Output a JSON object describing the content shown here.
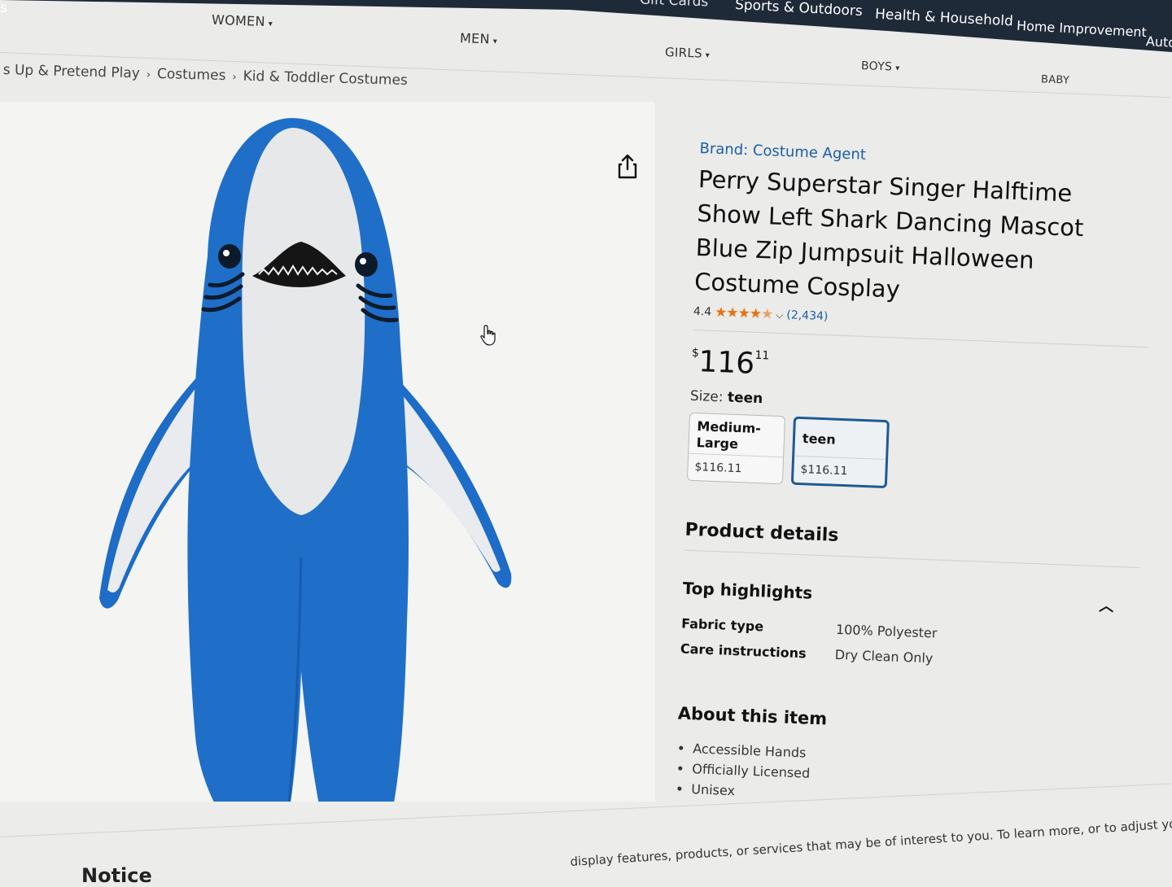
{
  "top_nav": {
    "items": [
      "Gift Cards",
      "Sports & Outdoors",
      "Health & Household",
      "Home Improvement",
      "Auto"
    ],
    "left_fragment": "s"
  },
  "categories": {
    "women": "WOMEN",
    "men": "MEN",
    "girls": "GIRLS",
    "boys": "BOYS",
    "baby": "BABY"
  },
  "breadcrumb": [
    "s Up & Pretend Play",
    "Costumes",
    "Kid & Toddler Costumes"
  ],
  "product": {
    "brand": "Brand: Costume Agent",
    "title": "Perry Superstar Singer Halftime Show Left Shark Dancing Mascot Blue Zip Jumpsuit Halloween Costume Cosplay",
    "rating": "4.4",
    "rating_value": 4.4,
    "rating_count": "(2,434)",
    "price_symbol": "$",
    "price_whole": "116",
    "price_fraction": "11",
    "size_label": "Size:",
    "size_selected": "teen",
    "sizes": [
      {
        "name": "Medium-Large",
        "price": "$116.11",
        "selected": false
      },
      {
        "name": "teen",
        "price": "$116.11",
        "selected": true
      }
    ]
  },
  "details": {
    "heading": "Product details",
    "subheading": "Top highlights",
    "rows": [
      {
        "key": "Fabric type",
        "value": "100% Polyester"
      },
      {
        "key": "Care instructions",
        "value": "Dry Clean Only"
      }
    ]
  },
  "about": {
    "heading": "About this item",
    "bullets": [
      "Accessible Hands",
      "Officially Licensed",
      "Unisex"
    ]
  },
  "footer": {
    "text": "display features, products, or services that may be of interest to you. To learn more, or to adjust your prefere",
    "notice": "Notice"
  },
  "colors": {
    "link": "#1b5fa8",
    "star": "#e8730c",
    "nav_bg": "#1f2a38",
    "shark_blue": "#1f6fc9",
    "selected_border": "#1e5a94"
  },
  "icons": [
    "share-icon",
    "hand-cursor-icon",
    "chevron-up-icon",
    "chevron-down-icon",
    "star-icon"
  ]
}
